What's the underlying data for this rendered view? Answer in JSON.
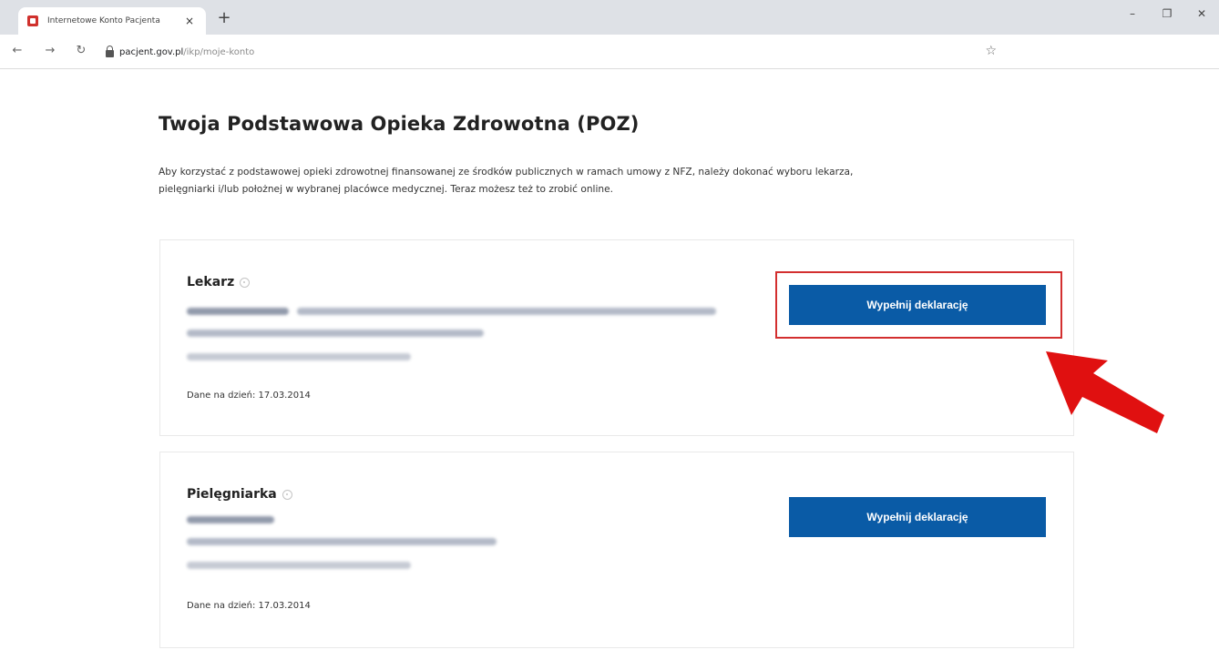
{
  "browser": {
    "tab_title": "Internetowe Konto Pacjenta",
    "tab_close": "×",
    "new_tab": "+",
    "win_min": "–",
    "win_restore": "❐",
    "win_close": "✕",
    "url_host": "pacjent.gov.pl",
    "url_path": "/ikp/moje-konto",
    "icons": [
      "back-arrow-icon",
      "forward-arrow-icon",
      "reload-icon",
      "lock-icon",
      "star-icon"
    ]
  },
  "page": {
    "title": "Twoja Podstawowa Opieka Zdrowotna (POZ)",
    "description": "Aby korzystać z podstawowej opieki zdrowotnej finansowanej ze środków publicznych w ramach umowy z NFZ, należy dokonać wyboru lekarza, pielęgniarki i/lub położnej w wybranej placówce medycznej. Teraz możesz też to zrobić online."
  },
  "cards": {
    "lekarz": {
      "heading": "Lekarz",
      "date": "Dane na dzień: 17.03.2014",
      "button_label": "Wypełnij deklarację"
    },
    "pielegniarka": {
      "heading": "Pielęgniarka",
      "date": "Dane na dzień: 17.03.2014",
      "button_label": "Wypełnij deklarację"
    }
  },
  "colors": {
    "primary_button": "#0a5ba6",
    "highlight": "#d32f2f",
    "arrow": "#e01010"
  }
}
